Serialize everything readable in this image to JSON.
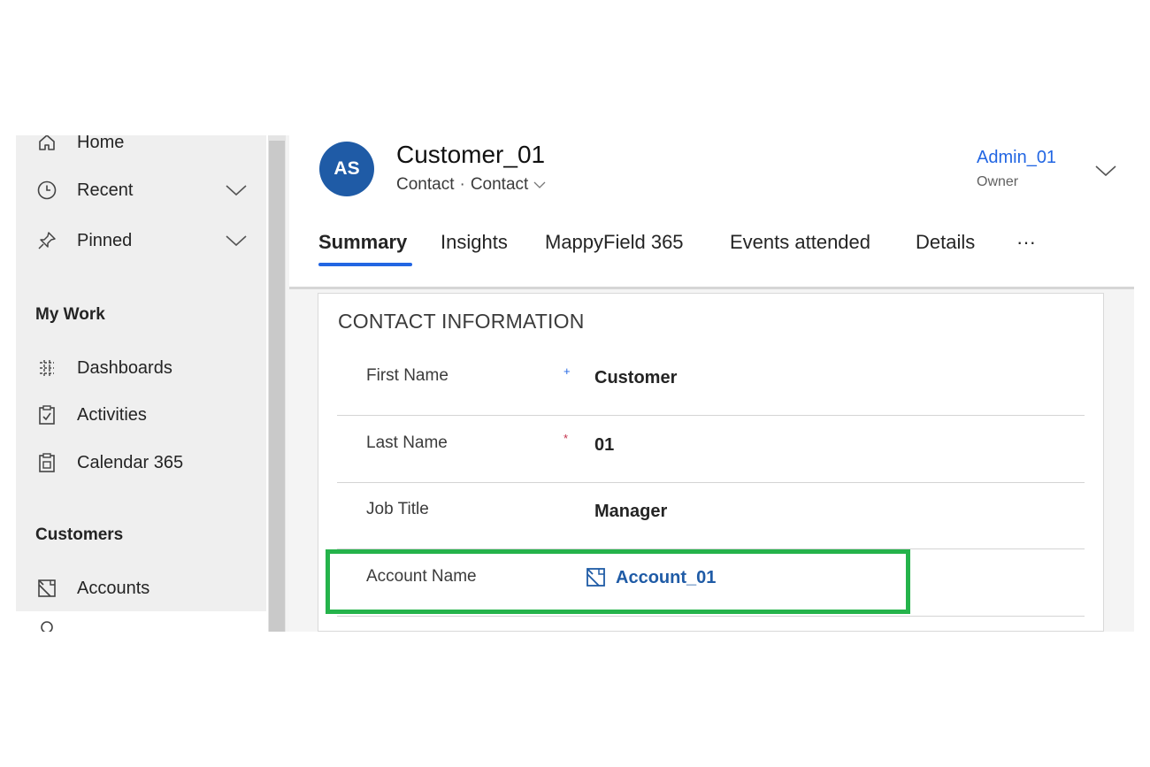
{
  "sidebar": {
    "top_items": [
      {
        "label": "Home",
        "icon": "home-icon"
      },
      {
        "label": "Recent",
        "icon": "clock-icon",
        "expandable": true
      },
      {
        "label": "Pinned",
        "icon": "pin-icon",
        "expandable": true
      }
    ],
    "sections": [
      {
        "title": "My Work",
        "items": [
          {
            "label": "Dashboards",
            "icon": "dashboard-icon"
          },
          {
            "label": "Activities",
            "icon": "clipboard-icon"
          },
          {
            "label": "Calendar 365",
            "icon": "calendar-icon"
          }
        ]
      },
      {
        "title": "Customers",
        "items": [
          {
            "label": "Accounts",
            "icon": "account-icon"
          }
        ]
      }
    ]
  },
  "record": {
    "avatar_initials": "AS",
    "title": "Customer_01",
    "entity": "Contact",
    "form_selector": "Contact",
    "owner_name": "Admin_01",
    "owner_label": "Owner"
  },
  "tabs": [
    {
      "label": "Summary",
      "active": true
    },
    {
      "label": "Insights",
      "active": false
    },
    {
      "label": "MappyField 365",
      "active": false
    },
    {
      "label": "Events attended",
      "active": false
    },
    {
      "label": "Details",
      "active": false
    },
    {
      "label": "···",
      "active": false
    }
  ],
  "card": {
    "title": "CONTACT INFORMATION",
    "fields": [
      {
        "label": "First Name",
        "required_marker": "+",
        "value": "Customer"
      },
      {
        "label": "Last Name",
        "required_marker": "*",
        "value": "01"
      },
      {
        "label": "Job Title",
        "required_marker": "",
        "value": "Manager"
      },
      {
        "label": "Account Name",
        "required_marker": "",
        "value": "Account_01",
        "lookup": true
      }
    ]
  },
  "colors": {
    "accent": "#2266e3",
    "avatar_bg": "#1f5ba6",
    "highlight_border": "#25b34b",
    "required_star": "#c4314b",
    "recommended_plus": "#2266e3"
  }
}
